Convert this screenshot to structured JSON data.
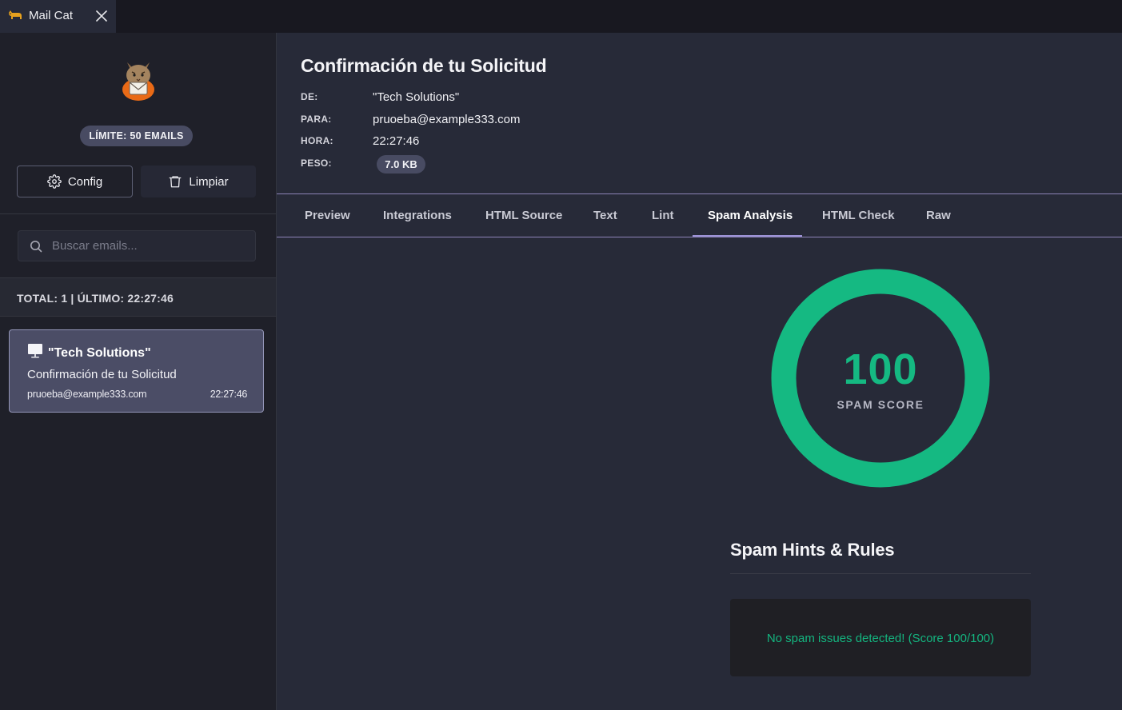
{
  "window": {
    "tab_title": "Mail Cat"
  },
  "sidebar": {
    "limit_badge": "LÍMITE: 50 EMAILS",
    "config_button": "Config",
    "clear_button": "Limpiar",
    "search_placeholder": "Buscar emails...",
    "totals": "TOTAL: 1 | ÚLTIMO: 22:27:46",
    "emails": [
      {
        "from": "\"Tech Solutions\"",
        "subject": "Confirmación de tu Solicitud",
        "to": "pruoeba@example333.com",
        "time": "22:27:46"
      }
    ]
  },
  "message": {
    "title": "Confirmación de tu Solicitud",
    "labels": {
      "from": "DE:",
      "to": "PARA:",
      "time": "HORA:",
      "size": "PESO:"
    },
    "from": "\"Tech Solutions\"",
    "to": "pruoeba@example333.com",
    "time": "22:27:46",
    "size": "7.0 KB"
  },
  "tabs": [
    "Preview",
    "Integrations",
    "HTML Source",
    "Text",
    "Lint",
    "Spam Analysis",
    "HTML Check",
    "Raw"
  ],
  "active_tab": "Spam Analysis",
  "spam": {
    "score": "100",
    "score_fraction": 1.0,
    "score_label": "SPAM SCORE",
    "hints_title": "Spam Hints & Rules",
    "result_message": "No spam issues detected! (Score 100/100)"
  },
  "colors": {
    "accent": "#9d93d6",
    "success": "#15b982",
    "sidebar_bg": "#1f2029",
    "main_bg": "#272a38"
  }
}
